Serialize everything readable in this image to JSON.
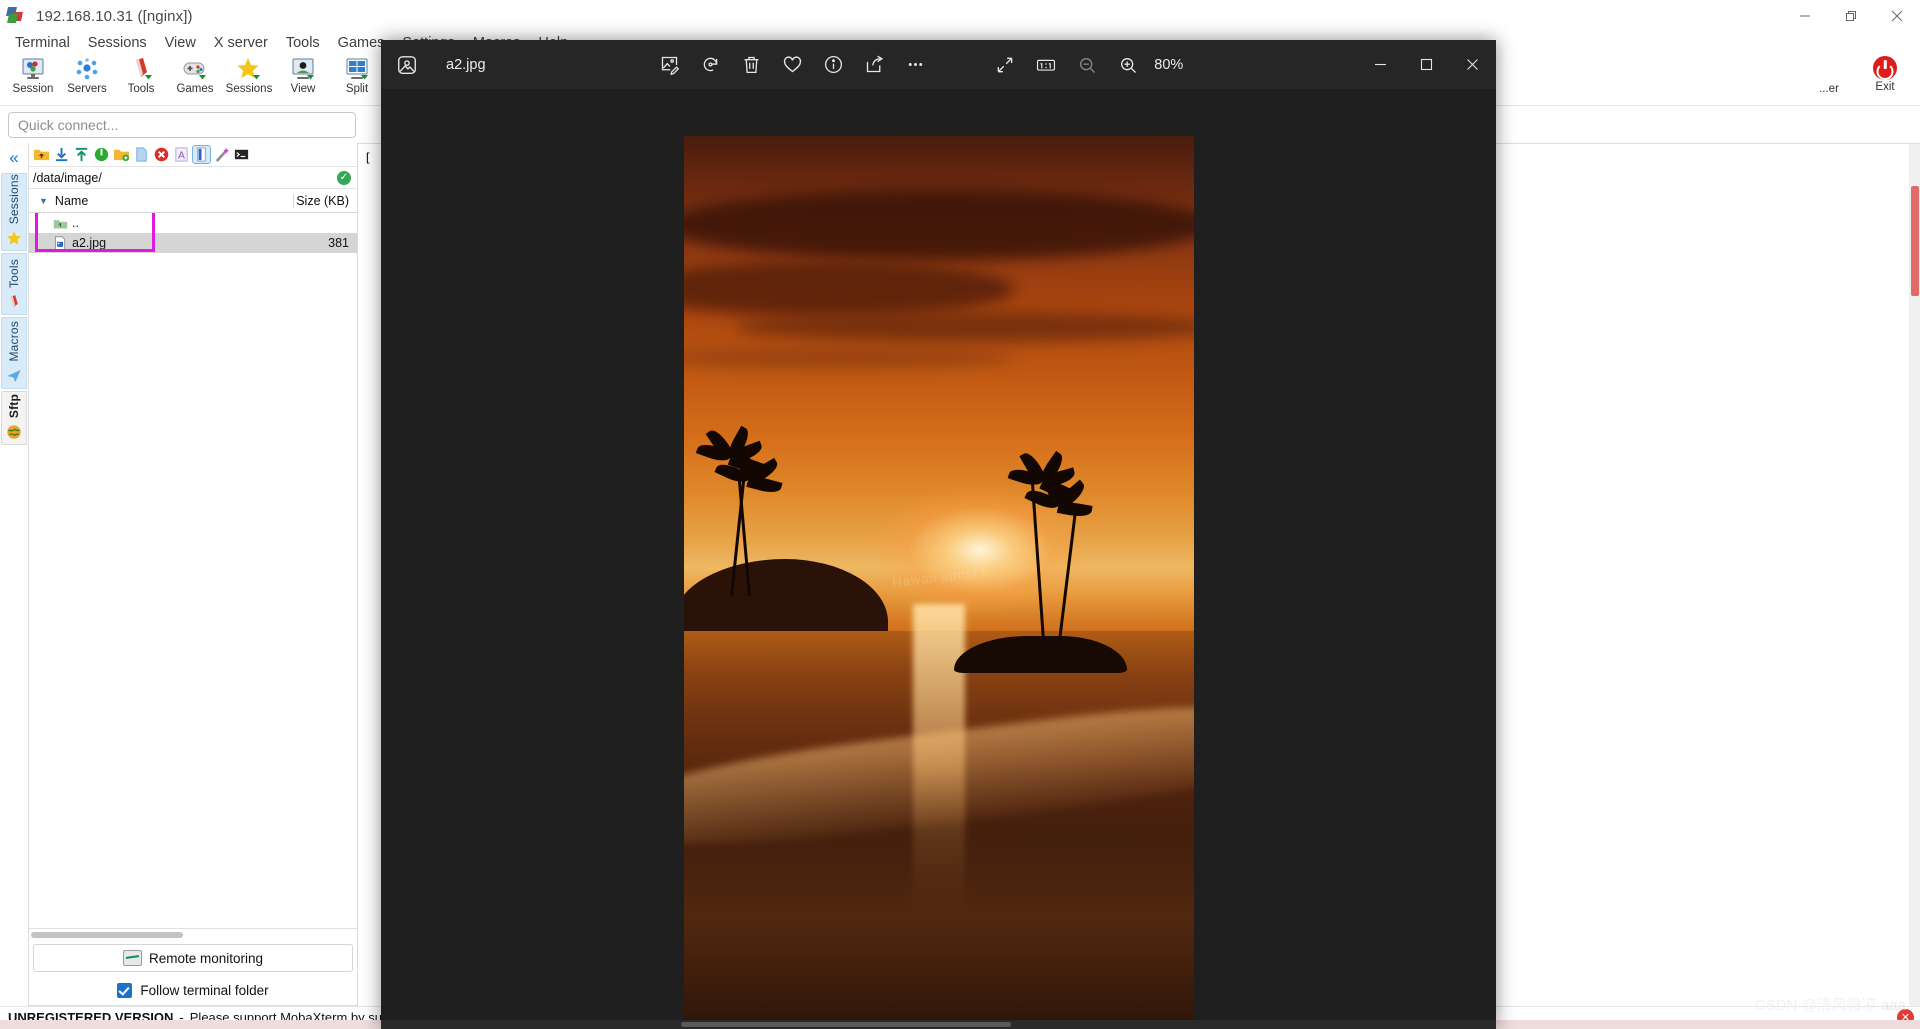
{
  "window": {
    "title": "192.168.10.31 ([nginx])",
    "app_icon": "mobaxterm-icon",
    "controls": {
      "minimize": "–",
      "restore": "❐",
      "close": "✕"
    }
  },
  "menubar": {
    "items": [
      "Terminal",
      "Sessions",
      "View",
      "X server",
      "Tools",
      "Games",
      "Settings",
      "Macros",
      "Help"
    ]
  },
  "toolbar": {
    "items": [
      {
        "label": "Session",
        "icon": "session-icon"
      },
      {
        "label": "Servers",
        "icon": "servers-icon"
      },
      {
        "label": "Tools",
        "icon": "tools-icon"
      },
      {
        "label": "Games",
        "icon": "games-icon"
      },
      {
        "label": "Sessions",
        "icon": "sessions-star-icon"
      },
      {
        "label": "View",
        "icon": "view-icon"
      },
      {
        "label": "Split",
        "icon": "split-icon"
      }
    ],
    "right": [
      {
        "label": "...er",
        "icon": "xserver-icon"
      },
      {
        "label": "Exit",
        "icon": "power-icon"
      }
    ]
  },
  "quick_connect": {
    "placeholder": "Quick connect..."
  },
  "sidebar_tabs": [
    {
      "label": "Sessions",
      "icon": "star-icon",
      "active": false
    },
    {
      "label": "Tools",
      "icon": "knife-icon",
      "active": false
    },
    {
      "label": "Macros",
      "icon": "plane-icon",
      "active": false
    },
    {
      "label": "Sftp",
      "icon": "globe-icon",
      "active": true
    }
  ],
  "sftp": {
    "collapse_icon": "chevron-double-left-icon",
    "toolbar_icons": [
      "folder-up-icon",
      "download-icon",
      "upload-icon",
      "refresh-icon",
      "new-folder-icon",
      "new-file-icon",
      "delete-icon",
      "text-mode-icon",
      "binary-mode-icon",
      "quick-edit-icon",
      "terminal-icon"
    ],
    "selected_toolbar_icon_index": 8,
    "path": "/data/image/",
    "path_status": "ok",
    "columns": {
      "name": "Name",
      "size": "Size (KB)"
    },
    "rows": [
      {
        "name": "..",
        "size": "",
        "icon": "folder-up-icon",
        "selected": false
      },
      {
        "name": "a2.jpg",
        "size": "381",
        "icon": "image-file-icon",
        "selected": true
      }
    ],
    "remote_monitoring": {
      "label": "Remote monitoring",
      "icon": "monitor-icon"
    },
    "follow_terminal_folder": {
      "label": "Follow terminal folder",
      "checked": true
    }
  },
  "terminal": {
    "prompt_fragment": "[ r"
  },
  "statusbar": {
    "bold": "UNREGISTERED VERSION",
    "separator": "-",
    "message": "Please support MobaXterm by subsc"
  },
  "viewer": {
    "app_icon": "photos-app-icon",
    "filename": "a2.jpg",
    "toolbar_buttons": [
      {
        "name": "edit-image-icon",
        "label": "Edit image"
      },
      {
        "name": "rotate-icon",
        "label": "Rotate"
      },
      {
        "name": "delete-icon",
        "label": "Delete"
      },
      {
        "name": "favorite-icon",
        "label": "Add to favorites"
      },
      {
        "name": "info-icon",
        "label": "File info"
      },
      {
        "name": "share-icon",
        "label": "Share"
      },
      {
        "name": "more-icon",
        "label": "See more"
      }
    ],
    "view_buttons": [
      {
        "name": "fullscreen-icon",
        "label": "Full screen"
      },
      {
        "name": "actual-size-icon",
        "label": "1:1"
      },
      {
        "name": "zoom-out-icon",
        "label": "Zoom out",
        "disabled": true
      },
      {
        "name": "zoom-in-icon",
        "label": "Zoom in"
      }
    ],
    "zoom_level": "80%",
    "window_controls": {
      "minimize": "–",
      "maximize": "▢",
      "close": "✕"
    },
    "image_watermark": "Hawaii sunset"
  },
  "page_watermark": {
    "prefix": "CSDN @",
    "name": "清风微凉",
    "suffix": "aaa"
  },
  "colors": {
    "accent_blue": "#1a73c8",
    "highlight_magenta": "#e018e0",
    "viewer_chrome": "#262626",
    "viewer_bg": "#1f1f1f",
    "exit_red": "#e01b1b"
  }
}
